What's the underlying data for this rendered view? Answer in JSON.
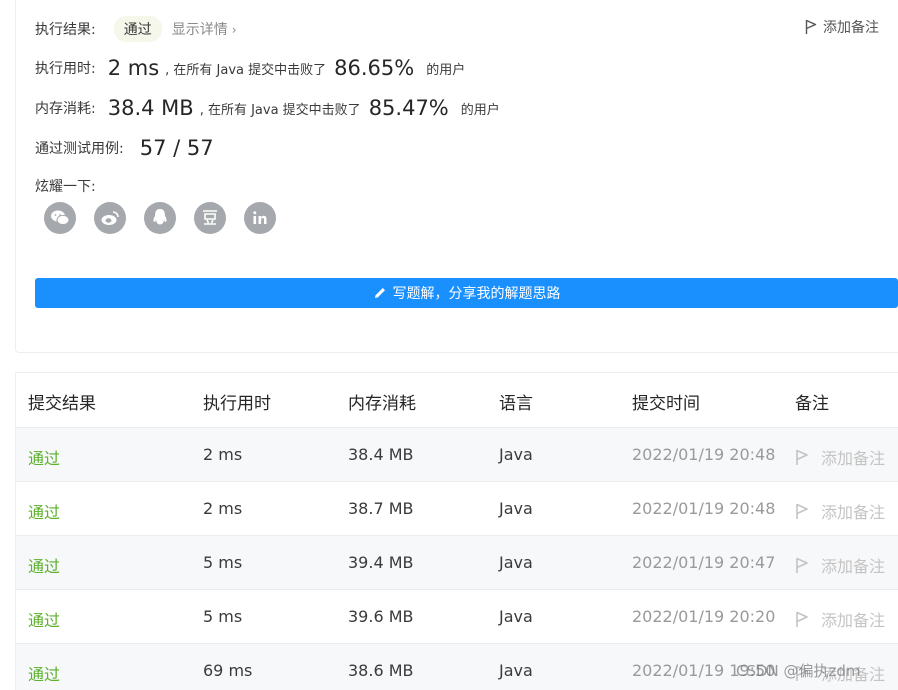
{
  "summary": {
    "result_label": "执行结果:",
    "result_value": "通过",
    "details_label": "显示详情",
    "add_note_label": "添加备注",
    "runtime_label": "执行用时:",
    "runtime_value": "2 ms",
    "runtime_text": ", 在所有 Java 提交中击败了",
    "runtime_percent": "86.65%",
    "runtime_suffix": "的用户",
    "memory_label": "内存消耗:",
    "memory_value": "38.4 MB",
    "memory_text": ", 在所有 Java 提交中击败了",
    "memory_percent": "85.47%",
    "memory_suffix": "的用户",
    "tests_label": "通过测试用例:",
    "tests_value": "57 / 57",
    "share_label": "炫耀一下:",
    "share_icons": [
      "wechat-icon",
      "weibo-icon",
      "qq-icon",
      "douban-icon",
      "linkedin-icon"
    ],
    "write_solution_label": "写题解，分享我的解题思路"
  },
  "table": {
    "headers": [
      "提交结果",
      "执行用时",
      "内存消耗",
      "语言",
      "提交时间",
      "备注"
    ],
    "rows": [
      {
        "result": "通过",
        "runtime": "2 ms",
        "memory": "38.4 MB",
        "lang": "Java",
        "time": "2022/01/19 20:48",
        "note": "添加备注"
      },
      {
        "result": "通过",
        "runtime": "2 ms",
        "memory": "38.7 MB",
        "lang": "Java",
        "time": "2022/01/19 20:48",
        "note": "添加备注"
      },
      {
        "result": "通过",
        "runtime": "5 ms",
        "memory": "39.4 MB",
        "lang": "Java",
        "time": "2022/01/19 20:47",
        "note": "添加备注"
      },
      {
        "result": "通过",
        "runtime": "5 ms",
        "memory": "39.6 MB",
        "lang": "Java",
        "time": "2022/01/19 20:20",
        "note": "添加备注"
      },
      {
        "result": "通过",
        "runtime": "69 ms",
        "memory": "38.6 MB",
        "lang": "Java",
        "time": "2022/01/19 19:50",
        "note": "添加备注"
      }
    ]
  },
  "watermark": "CSDN @偏执zdm",
  "colors": {
    "accent": "#1a90ff",
    "pass_green": "#5cb02c",
    "share_gray": "#a5a8ad"
  }
}
